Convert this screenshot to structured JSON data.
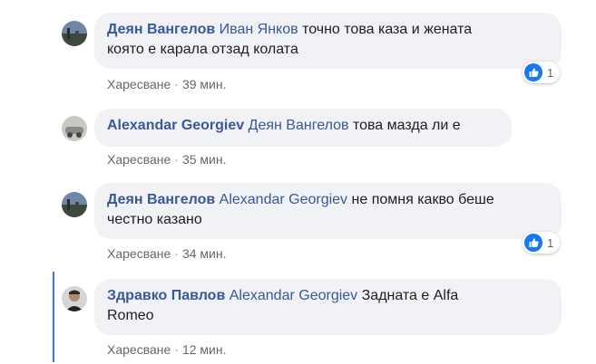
{
  "comments": [
    {
      "author": "Деян Вангелов",
      "mention": "Иван Янков",
      "line1": "точно това каза и жената",
      "line2": "която е карала отзад колата",
      "like_label": "Харесване",
      "time": "39 мин.",
      "reactions": "1",
      "avatar_icon": "user-avatar-landscape"
    },
    {
      "author": "Alexandar Georgiev",
      "mention": "Деян Вангелов",
      "line1": "това мазда ли е",
      "like_label": "Харесване",
      "time": "35 мин.",
      "avatar_icon": "user-avatar-car"
    },
    {
      "author": "Деян Вангелов",
      "mention": "Alexandar Georgiev",
      "line1": "не помня какво беше",
      "line2": "честно казано",
      "like_label": "Харесване",
      "time": "34 мин.",
      "reactions": "1",
      "avatar_icon": "user-avatar-landscape"
    },
    {
      "author": "Здравко Павлов",
      "mention": "Alexandar Georgiev",
      "line1": "Задната е Alfa",
      "line2": "Romeo",
      "like_label": "Харесване",
      "time": "12 мин.",
      "avatar_icon": "user-avatar-person"
    }
  ],
  "separator": "·",
  "colors": {
    "author": "#385898",
    "bubble": "#f0f2f5",
    "like_blue": "#1877f2",
    "thread_line": "#4a74c9"
  }
}
